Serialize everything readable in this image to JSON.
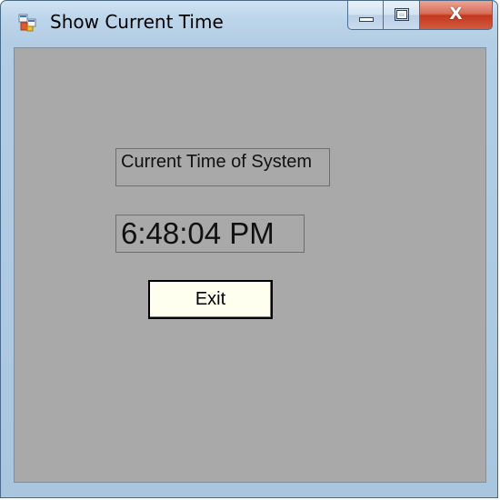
{
  "window": {
    "title": "Show Current Time",
    "icon": "windows-form-icon",
    "caption_buttons": {
      "minimize_icon": "minimize-icon",
      "maximize_icon": "maximize-icon",
      "close_icon": "close-icon",
      "close_glyph": "X"
    }
  },
  "form": {
    "caption_label": "Current Time of System",
    "time_value": "6:48:04 PM",
    "exit_label": "Exit"
  },
  "colors": {
    "client_background": "#a9a9a9",
    "button_background": "#fffff0",
    "close_button": "#c2381f"
  }
}
